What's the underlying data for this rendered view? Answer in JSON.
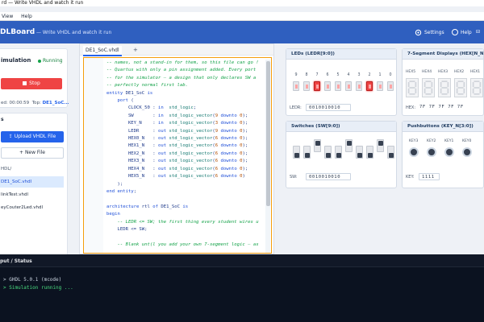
{
  "window": {
    "title": "rd — Write VHDL and watch it run"
  },
  "menu": {
    "items": [
      "View",
      "Help"
    ]
  },
  "header": {
    "brand": "DLBoard",
    "subtitle": "— Write VHDL and watch it run",
    "settings_label": "Settings",
    "help_label": "Help",
    "pin_label": "Pin"
  },
  "simulation": {
    "title": "imulation",
    "status": "Running",
    "stop_label": "Stop",
    "elapsed_label": "ed: 00:00:59",
    "top_label": "Top:",
    "top_value": "DE1_SoC..."
  },
  "files": {
    "section_label": "s",
    "upload_label": "Upload VHDL File",
    "new_label": "New File",
    "root": "HDL/",
    "items": [
      {
        "name": "DE1_SoC.vhdl",
        "selected": true
      },
      {
        "name": "linkTest.vhdl",
        "selected": false
      },
      {
        "name": "eyCouter2Led.vhdl",
        "selected": false
      }
    ]
  },
  "editor": {
    "tab": "DE1_SoC.vhdl",
    "tab_plus": "+",
    "lines": [
      "-- names, not a stand-in for them, so this file can go !",
      "-- Quartus with only a pin assignment added. Every port",
      "-- for the simulator — a design that only declares SW a",
      "-- perfectly normal first lab.",
      "entity DE1_SoC is",
      "    port (",
      "        CLOCK_50 : in  std_logic;",
      "        SW       : in  std_logic_vector(9 downto 0);",
      "        KEY_N    : in  std_logic_vector(3 downto 0);",
      "        LEDR     : out std_logic_vector(9 downto 0);",
      "        HEX0_N   : out std_logic_vector(6 downto 0);",
      "        HEX1_N   : out std_logic_vector(6 downto 0);",
      "        HEX2_N   : out std_logic_vector(6 downto 0);",
      "        HEX3_N   : out std_logic_vector(6 downto 0);",
      "        HEX4_N   : out std_logic_vector(6 downto 0);",
      "        HEX5_N   : out std_logic_vector(6 downto 0)",
      "    );",
      "end entity;",
      "",
      "architecture rtl of DE1_SoC is",
      "begin",
      "    -- LEDR <= SW; the first thing every student wires u",
      "    LEDR <= SW;",
      "",
      "    -- Blank unt(l you add your own 7-segment logic — as"
    ]
  },
  "leds": {
    "title": "LEDs (LEDR[9:0])",
    "indices": [
      "9",
      "8",
      "7",
      "6",
      "5",
      "4",
      "3",
      "2",
      "1",
      "0"
    ],
    "states": [
      0,
      0,
      1,
      0,
      0,
      0,
      0,
      1,
      0,
      0
    ],
    "readout_label": "LEDR:",
    "readout": "0010010010"
  },
  "hex": {
    "title": "7-Segment Displays (HEX[N_N[6:0])",
    "labels": [
      "HEX5",
      "HEX4",
      "HEX3",
      "HEX2",
      "HEX1"
    ],
    "readout_label": "HEX:",
    "readout": "7F 7F 7F 7F 7F"
  },
  "switches": {
    "title": "Switches (SW[9:0])",
    "states": [
      0,
      0,
      1,
      0,
      0,
      1,
      0,
      0,
      1,
      0
    ],
    "readout_label": "SW:",
    "readout": "0010010010"
  },
  "keys": {
    "title": "Pushbuttons (KEY_N[3:0])",
    "labels": [
      "KEY3",
      "KEY2",
      "KEY1",
      "KEY0"
    ],
    "readout_label": "KEY:",
    "readout": "1111"
  },
  "console": {
    "title": "put / Status",
    "line1": "GHDL 5.0.1 (mcode)",
    "line2": "Simulation running ..."
  },
  "colors": {
    "header": "#2f5fbf",
    "stop": "#ef4444",
    "accent": "#2563eb",
    "led_on": "#ef4444"
  }
}
